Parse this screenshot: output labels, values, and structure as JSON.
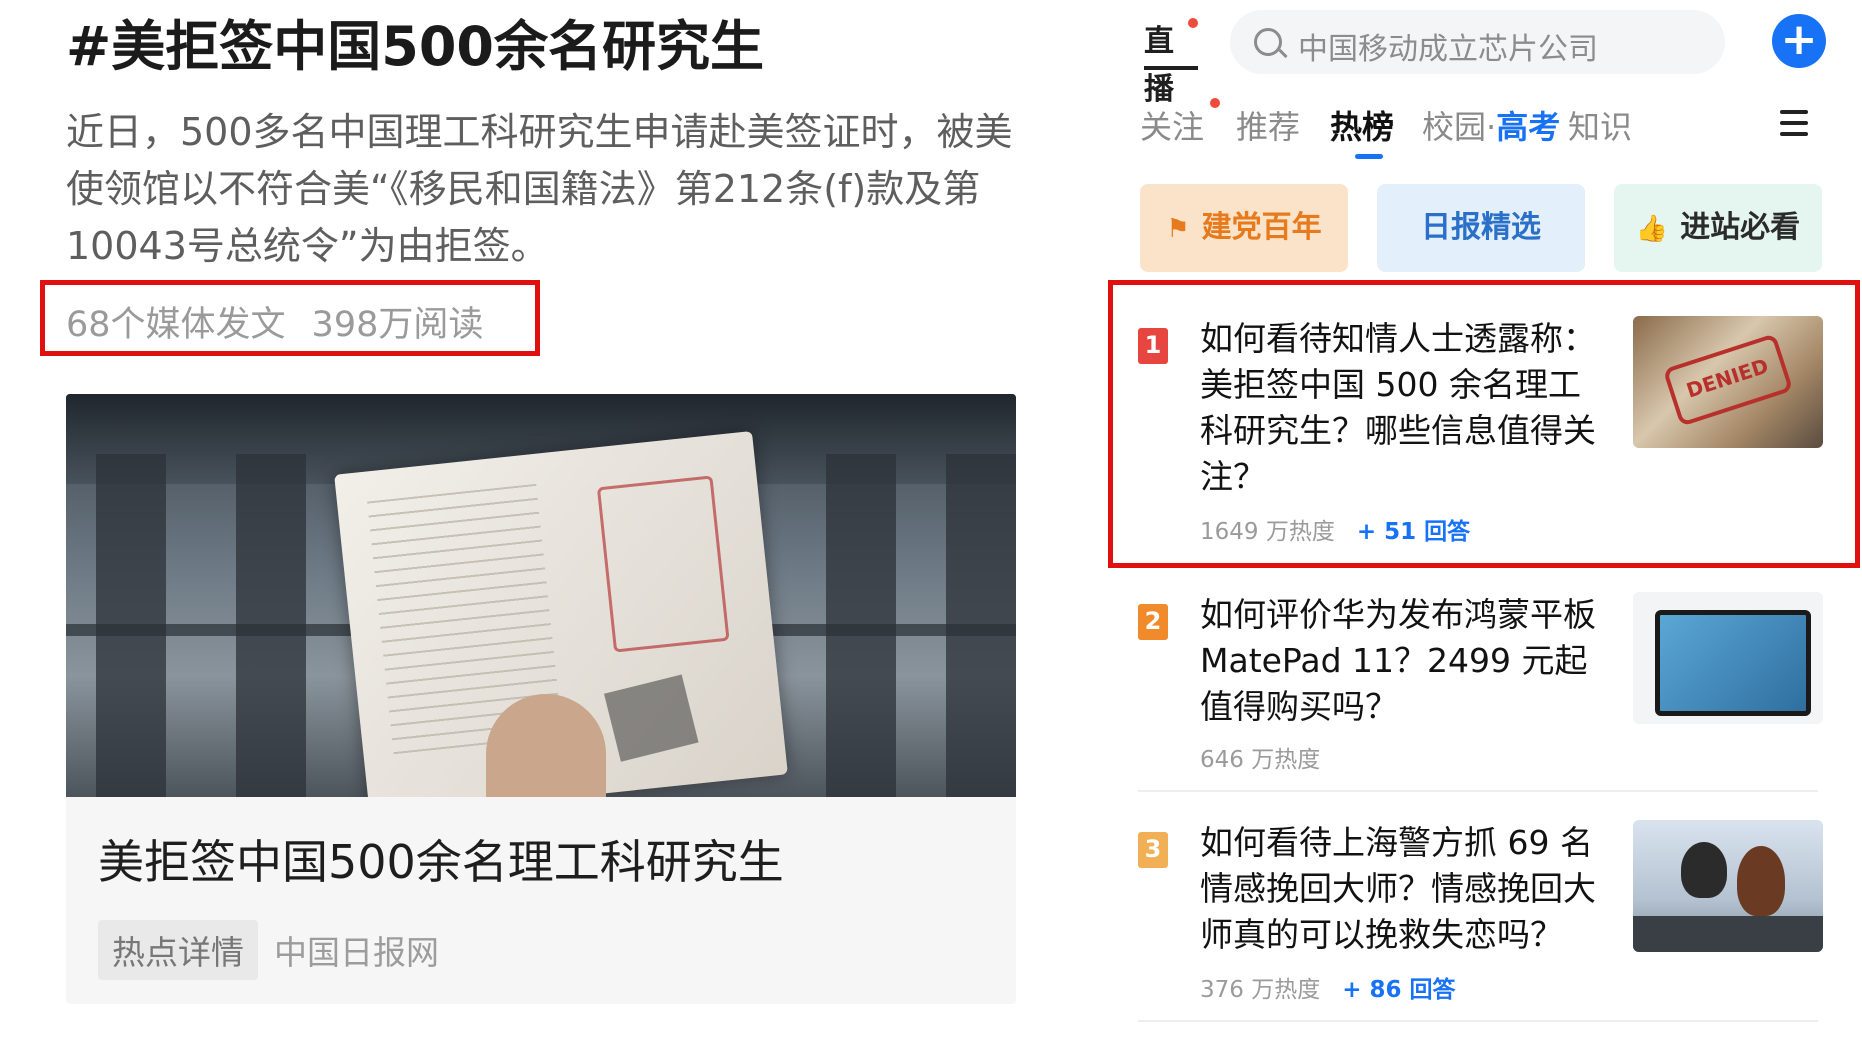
{
  "left": {
    "hashtag_title": "#美拒签中国500余名研究生",
    "summary": "近日，500多名中国理工科研究生申请赴美签证时，被美使领馆以不符合美“《移民和国籍法》第212条(f)款及第10043号总统令”为由拒签。",
    "stats": {
      "media": "68个媒体发文",
      "reads": "398万阅读"
    },
    "card": {
      "title": "美拒签中国500余名理工科研究生",
      "tag": "热点详情",
      "source": "中国日报网"
    },
    "highlight_color": "#e01010"
  },
  "right": {
    "live_label": "直播",
    "search_placeholder": "中国移动成立芯片公司",
    "add_label": "+",
    "tabs": [
      {
        "label": "关注"
      },
      {
        "label": "推荐"
      },
      {
        "label": "热榜"
      },
      {
        "label_a": "校园·",
        "label_b": "高考"
      },
      {
        "label": "知识"
      }
    ],
    "active_tab": "热榜",
    "chips": [
      {
        "icon": "flag-icon",
        "label": "建党百年"
      },
      {
        "label": "日报精选"
      },
      {
        "icon": "thumbs-up-icon",
        "label": "进站必看"
      }
    ],
    "hot_list": [
      {
        "rank": "1",
        "title": "如何看待知情人士透露称：美拒签中国 500 余名理工科研究生？哪些信息值得关注？",
        "heat": "1649 万热度",
        "answers": "+ 51 回答",
        "thumb_text": "DENIED"
      },
      {
        "rank": "2",
        "title": "如何评价华为发布鸿蒙平板 MatePad 11？2499 元起值得购买吗？",
        "heat": "646 万热度",
        "answers": ""
      },
      {
        "rank": "3",
        "title": "如何看待上海警方抓 69 名情感挽回大师？情感挽回大师真的可以挽救失恋吗？",
        "heat": "376 万热度",
        "answers": "+ 86 回答"
      }
    ],
    "accent_color": "#1772f6"
  }
}
